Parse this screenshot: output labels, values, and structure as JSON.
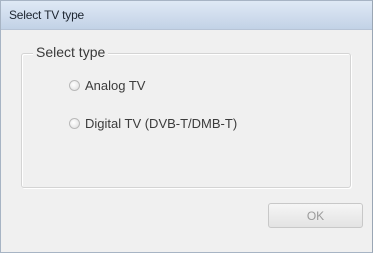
{
  "window": {
    "title": "Select TV type"
  },
  "group": {
    "label": "Select type",
    "options": [
      {
        "label": "Analog TV",
        "selected": false
      },
      {
        "label": "Digital TV (DVB-T/DMB-T)",
        "selected": false
      }
    ]
  },
  "buttons": {
    "ok_label": "OK",
    "ok_enabled": false
  }
}
